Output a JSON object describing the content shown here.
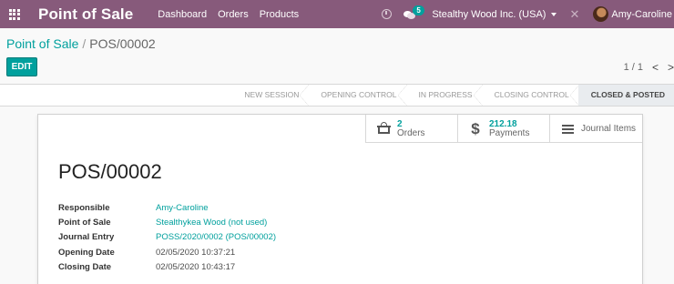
{
  "navbar": {
    "app_title": "Point of Sale",
    "menu": [
      "Dashboard",
      "Orders",
      "Products"
    ],
    "message_count": "5",
    "company": "Stealthy Wood Inc. (USA)",
    "user": "Amy-Caroline",
    "accent_color": "#875a7b"
  },
  "breadcrumb": {
    "parent": "Point of Sale",
    "separator": "/",
    "current": "POS/00002"
  },
  "actions": {
    "edit_label": "EDIT"
  },
  "pager": {
    "value": "1 / 1",
    "prev": "<",
    "next": ">"
  },
  "status": {
    "stages": [
      "NEW SESSION",
      "OPENING CONTROL",
      "IN PROGRESS",
      "CLOSING CONTROL",
      "CLOSED & POSTED"
    ],
    "active": "CLOSED & POSTED"
  },
  "smart_buttons": {
    "orders": {
      "value": "2",
      "label": "Orders"
    },
    "payments": {
      "value": "212.18",
      "label": "Payments"
    },
    "journal": {
      "label": "Journal Items"
    }
  },
  "record": {
    "title": "POS/00002",
    "fields": [
      {
        "label": "Responsible",
        "value": "Amy-Caroline"
      },
      {
        "label": "Point of Sale",
        "value": "Stealthykea Wood (not used)"
      },
      {
        "label": "Journal Entry",
        "value": "POSS/2020/0002 (POS/00002)"
      },
      {
        "label": "Opening Date",
        "value": "02/05/2020 10:37:21"
      },
      {
        "label": "Closing Date",
        "value": "02/05/2020 10:43:17"
      }
    ]
  }
}
